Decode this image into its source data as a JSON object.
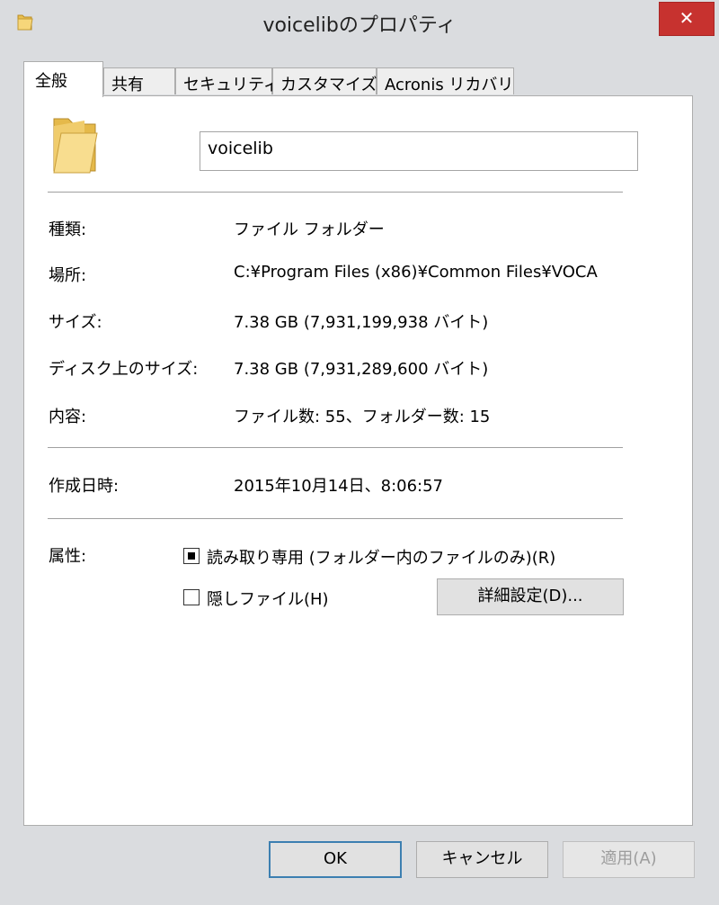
{
  "window": {
    "title": "voicelibのプロパティ",
    "close_glyph": "✕"
  },
  "tabs": [
    "全般",
    "共有",
    "セキュリティ",
    "カスタマイズ",
    "Acronis リカバリ"
  ],
  "name_field": {
    "value": "voicelib"
  },
  "properties": [
    {
      "label": "種類:",
      "value": "ファイル フォルダー"
    },
    {
      "label": "場所:",
      "value": "C:¥Program Files (x86)¥Common Files¥VOCA"
    },
    {
      "label": "サイズ:",
      "value": "7.38 GB (7,931,199,938 バイト)"
    },
    {
      "label": "ディスク上のサイズ:",
      "value": "7.38 GB (7,931,289,600 バイト)"
    },
    {
      "label": "内容:",
      "value": "ファイル数: 55、フォルダー数: 15"
    }
  ],
  "created": {
    "label": "作成日時:",
    "value": "2015年10月14日、8:06:57"
  },
  "attributes": {
    "label": "属性:",
    "readonly_label": "読み取り専用 (フォルダー内のファイルのみ)(R)",
    "hidden_label": "隠しファイル(H)",
    "advanced_button": "詳細設定(D)..."
  },
  "footer": {
    "ok": "OK",
    "cancel": "キャンセル",
    "apply": "適用(A)"
  },
  "colors": {
    "close": "#c7322f",
    "default_button_border": "#3c7fb1",
    "folder": "#f3d27a"
  }
}
